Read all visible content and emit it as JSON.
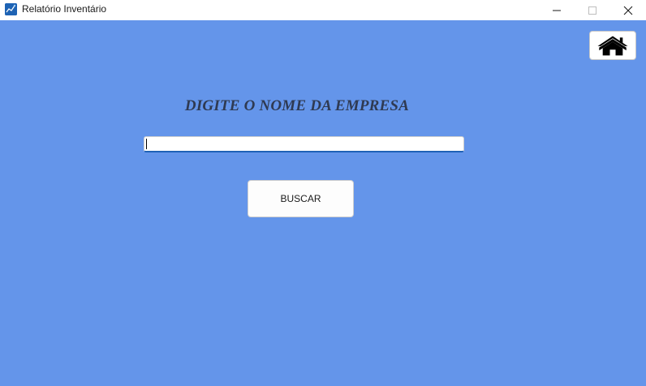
{
  "window": {
    "title": "Relatório Inventário",
    "icon": "app-icon",
    "controls": [
      "minimize-icon",
      "maximize-icon",
      "close-icon"
    ]
  },
  "home_button": {
    "icon": "home-icon"
  },
  "form": {
    "prompt": "DIGITE O NOME DA EMPRESA",
    "company_input": {
      "value": "",
      "placeholder": ""
    },
    "search_label": "BUSCAR"
  },
  "colors": {
    "background": "#6495ea",
    "titlebar": "#ffffff",
    "prompt_text": "#2f3a52",
    "input_accent": "#1f62b6"
  }
}
